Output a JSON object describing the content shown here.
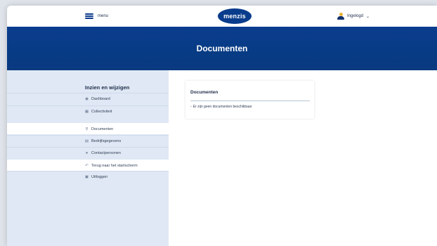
{
  "topbar": {
    "menu_label": "menu",
    "logo_text": "menzis",
    "user_label": "Ingelogd"
  },
  "hero": {
    "title": "Documenten"
  },
  "sidebar": {
    "title": "Inzien en wijzigen",
    "items": [
      {
        "label": "Dashboard",
        "icon": "dashboard-icon",
        "active": false
      },
      {
        "label": "Collectiviteit",
        "icon": "building-icon",
        "active": false
      },
      {
        "label": "Documenten",
        "icon": "paperclip-icon",
        "active": true
      },
      {
        "label": "Bedrijfsgegevens",
        "icon": "document-icon",
        "active": false
      },
      {
        "label": "Contactpersonen",
        "icon": "people-icon",
        "active": false
      },
      {
        "label": "Terug naar het startscherm",
        "icon": "return-icon",
        "active": true
      },
      {
        "label": "Uitloggen",
        "icon": "lock-icon",
        "active": false
      }
    ]
  },
  "main": {
    "card_title": "Documenten",
    "message": "Er zijn geen documenten beschikbaar"
  },
  "colors": {
    "brand_blue": "#0b3d8e",
    "sidebar_bg": "#dfe8f4",
    "accent_yellow": "#e8b23a"
  }
}
